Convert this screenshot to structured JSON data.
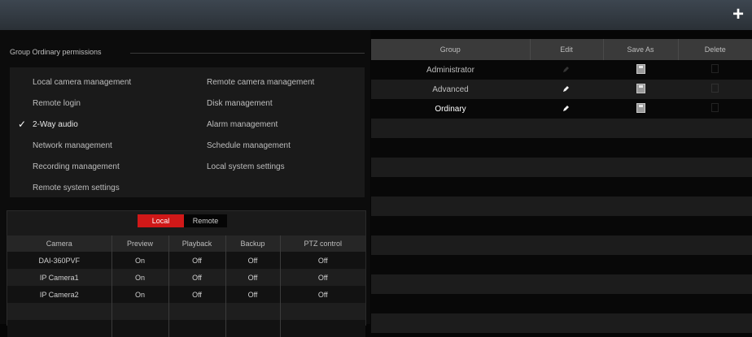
{
  "toolbar": {
    "add_icon": "plus-icon",
    "add_label": "+"
  },
  "permissions": {
    "title": "Group Ordinary permissions",
    "items": [
      {
        "label": "Local camera management",
        "checked": false
      },
      {
        "label": "Remote camera management",
        "checked": false
      },
      {
        "label": "Remote login",
        "checked": false
      },
      {
        "label": "Disk management",
        "checked": false
      },
      {
        "label": "2-Way audio",
        "checked": true
      },
      {
        "label": "Alarm management",
        "checked": false
      },
      {
        "label": "Network management",
        "checked": false
      },
      {
        "label": "Schedule management",
        "checked": false
      },
      {
        "label": "Recording management",
        "checked": false
      },
      {
        "label": "Local system settings",
        "checked": false
      },
      {
        "label": "Remote system settings",
        "checked": false
      }
    ]
  },
  "camera_tabs": {
    "local": "Local",
    "remote": "Remote",
    "active": "Local"
  },
  "camera_table": {
    "headers": [
      "Camera",
      "Preview",
      "Playback",
      "Backup",
      "PTZ control"
    ],
    "rows": [
      [
        "DAI-360PVF",
        "On",
        "Off",
        "Off",
        "Off"
      ],
      [
        "IP Camera1",
        "On",
        "Off",
        "Off",
        "Off"
      ],
      [
        "IP Camera2",
        "On",
        "Off",
        "Off",
        "Off"
      ]
    ]
  },
  "group_table": {
    "headers": [
      "Group",
      "Edit",
      "Save As",
      "Delete"
    ],
    "rows": [
      {
        "group": "Administrator",
        "edit_icon": "pencil-icon",
        "save_icon": "save-icon",
        "delete_icon": "trash-icon",
        "edit_enabled": false,
        "delete_enabled": false,
        "selected": false
      },
      {
        "group": "Advanced",
        "edit_icon": "pencil-icon",
        "save_icon": "save-icon",
        "delete_icon": "trash-icon",
        "edit_enabled": true,
        "delete_enabled": false,
        "selected": false
      },
      {
        "group": "Ordinary",
        "edit_icon": "pencil-icon",
        "save_icon": "save-icon",
        "delete_icon": "trash-icon",
        "edit_enabled": true,
        "delete_enabled": false,
        "selected": true
      }
    ]
  },
  "colors": {
    "accent_red": "#d01818",
    "background": "#060606",
    "header_bar": "#3a3a3a"
  }
}
